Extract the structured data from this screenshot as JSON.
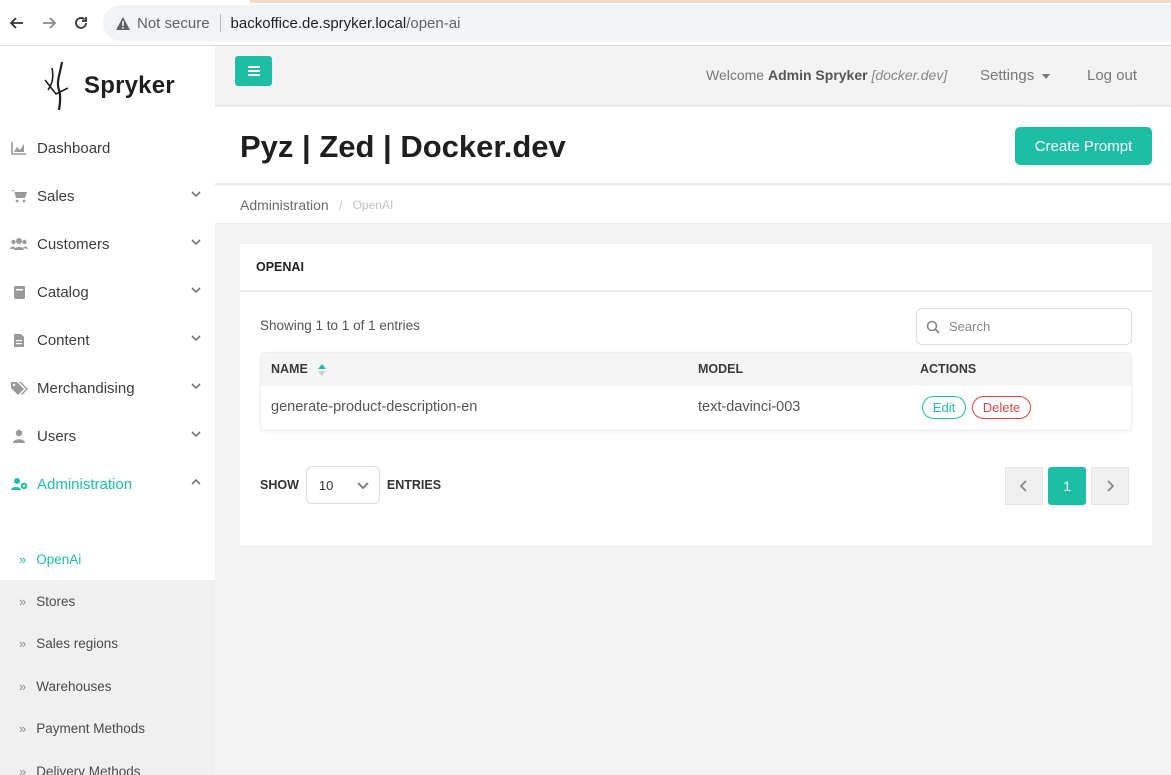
{
  "browser": {
    "not_secure": "Not secure",
    "host": "backoffice.de.spryker.local",
    "path": "/open-ai"
  },
  "brand": {
    "name": "Spryker",
    "accent": "#1ebea5",
    "danger": "#e04545"
  },
  "header": {
    "welcome_prefix": "Welcome",
    "user": "Admin Spryker",
    "env": "[docker.dev]",
    "settings": "Settings",
    "logout": "Log out"
  },
  "sidebar": {
    "items": [
      {
        "label": "Dashboard",
        "icon": "chart-icon",
        "has_children": false
      },
      {
        "label": "Sales",
        "icon": "cart-icon",
        "has_children": true
      },
      {
        "label": "Customers",
        "icon": "users-icon",
        "has_children": true
      },
      {
        "label": "Catalog",
        "icon": "book-icon",
        "has_children": true
      },
      {
        "label": "Content",
        "icon": "file-icon",
        "has_children": true
      },
      {
        "label": "Merchandising",
        "icon": "tags-icon",
        "has_children": true
      },
      {
        "label": "Users",
        "icon": "user-icon",
        "has_children": true
      },
      {
        "label": "Administration",
        "icon": "admin-users-icon",
        "has_children": true,
        "expanded": true
      }
    ],
    "subitems": [
      {
        "label": "OpenAi",
        "active": true
      },
      {
        "label": "Stores"
      },
      {
        "label": "Sales regions"
      },
      {
        "label": "Warehouses"
      },
      {
        "label": "Payment Methods"
      },
      {
        "label": "Delivery Methods"
      }
    ]
  },
  "page": {
    "title": "Pyz | Zed | Docker.dev",
    "create_button": "Create Prompt",
    "breadcrumb": [
      "Administration",
      "OpenAI"
    ]
  },
  "panel": {
    "title": "OPENAI",
    "info": "Showing 1 to 1 of 1 entries",
    "search_placeholder": "Search",
    "columns": [
      "NAME",
      "MODEL",
      "ACTIONS"
    ],
    "rows": [
      {
        "name": "generate-product-description-en",
        "model": "text-davinci-003",
        "edit": "Edit",
        "delete": "Delete"
      }
    ],
    "show_label": "SHOW",
    "entries_label": "ENTRIES",
    "page_size": "10",
    "current_page": "1"
  }
}
